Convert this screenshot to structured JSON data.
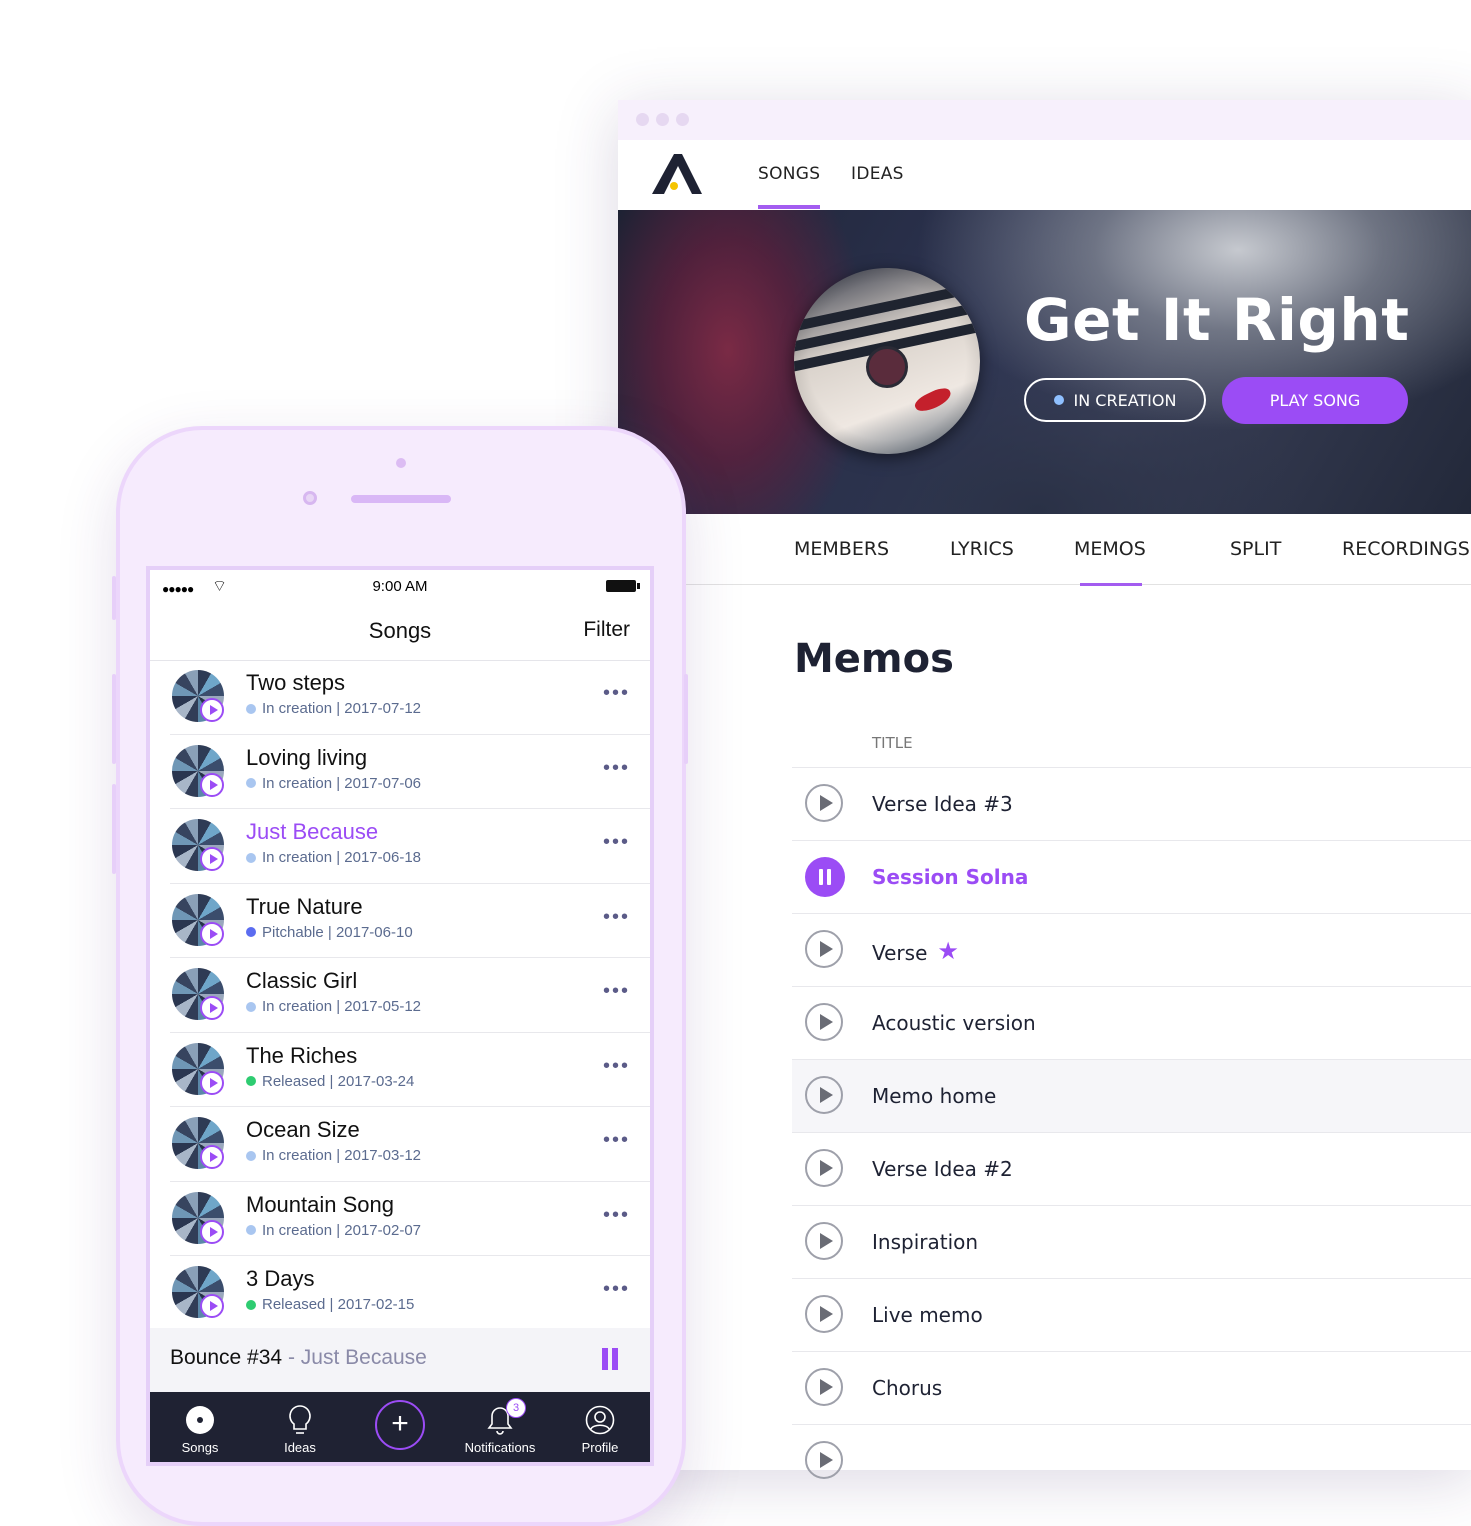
{
  "desktop": {
    "nav": {
      "songs": "SONGS",
      "ideas": "IDEAS"
    },
    "hero": {
      "title": "Get It Right",
      "status": "IN CREATION",
      "play": "PLAY SONG"
    },
    "tabs": [
      "MEMBERS",
      "LYRICS",
      "MEMOS",
      "SPLIT",
      "RECORDINGS"
    ],
    "memos": {
      "heading": "Memos",
      "column_title": "TITLE",
      "items": [
        "Verse Idea #3",
        "Session Solna",
        "Verse",
        "Acoustic version",
        "Memo home",
        "Verse Idea #2",
        "Inspiration",
        "Live memo",
        "Chorus"
      ]
    },
    "colors": {
      "accent": "#9b4cf5",
      "dark": "#1e2233"
    }
  },
  "phone": {
    "status": {
      "time": "9:00 AM"
    },
    "header": {
      "title": "Songs",
      "filter": "Filter"
    },
    "songs": [
      {
        "title": "Two steps",
        "meta": "In creation | 2017-07-12",
        "dot": "#a9c6f0"
      },
      {
        "title": "Loving living",
        "meta": "In creation | 2017-07-06",
        "dot": "#a9c6f0"
      },
      {
        "title": "Just Because",
        "meta": "In creation | 2017-06-18",
        "dot": "#a9c6f0"
      },
      {
        "title": "True Nature",
        "meta": "Pitchable | 2017-06-10",
        "dot": "#5b6cf0"
      },
      {
        "title": "Classic Girl",
        "meta": "In creation | 2017-05-12",
        "dot": "#a9c6f0"
      },
      {
        "title": "The Riches",
        "meta": "Released | 2017-03-24",
        "dot": "#2ecc71"
      },
      {
        "title": "Ocean Size",
        "meta": "In creation | 2017-03-12",
        "dot": "#a9c6f0"
      },
      {
        "title": "Mountain Song",
        "meta": "In creation | 2017-02-07",
        "dot": "#a9c6f0"
      },
      {
        "title": "3 Days",
        "meta": "Released | 2017-02-15",
        "dot": "#2ecc71"
      }
    ],
    "now_playing": {
      "title": "Bounce #34",
      "sub": "- Just Because"
    },
    "tabbar": {
      "songs": "Songs",
      "ideas": "Ideas",
      "notifications": "Notifications",
      "notifications_badge": "3",
      "profile": "Profile",
      "add": "+"
    }
  }
}
